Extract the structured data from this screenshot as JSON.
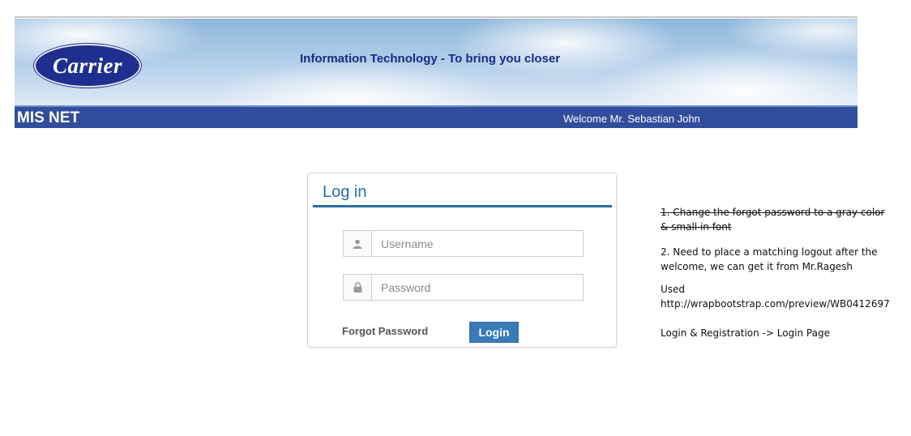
{
  "header": {
    "brand": "Carrier",
    "tagline": "Information Technology - To bring you closer"
  },
  "navbar": {
    "title": "MIS NET",
    "welcome": "Welcome Mr. Sebastian John"
  },
  "login": {
    "title": "Log in",
    "username_placeholder": "Username",
    "password_placeholder": "Password",
    "forgot_label": "Forgot Password",
    "submit_label": "Login",
    "icons": [
      "user-icon",
      "lock-icon"
    ]
  },
  "notes": {
    "item1_line1": "1. Change the forgot password to a gray color",
    "item1_line2": "& small in font",
    "item2_line1": "2. Need to place a matching logout after the",
    "item2_line2": "welcome, we can get it from Mr.Ragesh",
    "used_label": "Used",
    "used_url": "http://wrapbootstrap.com/preview/WB0412697",
    "path": "Login & Registration -> Login  Page"
  },
  "colors": {
    "nav_bg": "#324d9b",
    "accent": "#2a6ea6",
    "button": "#3a7ab8",
    "tagline": "#1a2a86"
  }
}
